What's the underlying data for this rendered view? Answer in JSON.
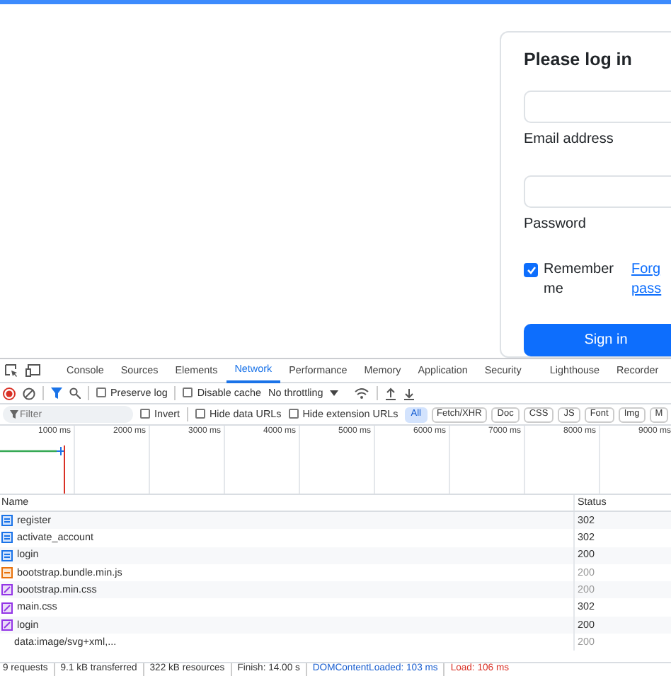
{
  "login": {
    "title": "Please log in",
    "fields": [
      {
        "label": "Email address"
      },
      {
        "label": "Password"
      }
    ],
    "remember": {
      "label": "Remember me",
      "checked": true
    },
    "forgot_link": [
      "Forg",
      "pass"
    ],
    "submit": "Sign in"
  },
  "devtools": {
    "tabs": [
      {
        "label": "Console",
        "selected": false
      },
      {
        "label": "Sources",
        "selected": false
      },
      {
        "label": "Elements",
        "selected": false
      },
      {
        "label": "Network",
        "selected": true
      },
      {
        "label": "Performance",
        "selected": false
      },
      {
        "label": "Memory",
        "selected": false
      },
      {
        "label": "Application",
        "selected": false
      },
      {
        "label": "Security",
        "selected": false
      },
      {
        "label": "Lighthouse",
        "selected": false
      },
      {
        "label": "Recorder",
        "selected": false
      }
    ],
    "toolbar": {
      "preserve_log": {
        "label": "Preserve log",
        "checked": false
      },
      "disable_cache": {
        "label": "Disable cache",
        "checked": false
      },
      "throttling": "No throttling"
    },
    "filter": {
      "placeholder": "Filter",
      "invert": {
        "label": "Invert",
        "checked": false
      },
      "hide_data_urls": {
        "label": "Hide data URLs",
        "checked": false
      },
      "hide_extension_urls": {
        "label": "Hide extension URLs",
        "checked": false
      },
      "types": [
        {
          "label": "All",
          "selected": true
        },
        {
          "label": "Fetch/XHR",
          "selected": false
        },
        {
          "label": "Doc",
          "selected": false
        },
        {
          "label": "CSS",
          "selected": false
        },
        {
          "label": "JS",
          "selected": false
        },
        {
          "label": "Font",
          "selected": false
        },
        {
          "label": "Img",
          "selected": false
        },
        {
          "label": "M",
          "selected": false
        }
      ]
    },
    "timeline": {
      "ticks": [
        "1000 ms",
        "2000 ms",
        "3000 ms",
        "4000 ms",
        "5000 ms",
        "6000 ms",
        "7000 ms",
        "8000 ms",
        "9000 ms"
      ]
    },
    "table": {
      "columns": [
        "Name",
        "Status"
      ],
      "rows": [
        {
          "name": "register",
          "kind": "document",
          "status": "302",
          "dimmed": false
        },
        {
          "name": "activate_account",
          "kind": "document",
          "status": "302",
          "dimmed": false
        },
        {
          "name": "login",
          "kind": "document",
          "status": "200",
          "dimmed": false
        },
        {
          "name": "bootstrap.bundle.min.js",
          "kind": "script",
          "status": "200",
          "dimmed": true
        },
        {
          "name": "bootstrap.min.css",
          "kind": "stylesheet",
          "status": "200",
          "dimmed": true
        },
        {
          "name": "main.css",
          "kind": "stylesheet",
          "status": "302",
          "dimmed": false
        },
        {
          "name": "login",
          "kind": "stylesheet",
          "status": "200",
          "dimmed": false
        },
        {
          "name": "data:image/svg+xml,...",
          "kind": "image",
          "status": "200",
          "dimmed": true
        }
      ]
    },
    "status_bar": [
      {
        "text": "9 requests",
        "kind": "plain"
      },
      {
        "text": "9.1 kB transferred",
        "kind": "plain"
      },
      {
        "text": "322 kB resources",
        "kind": "plain"
      },
      {
        "text": "Finish: 14.00 s",
        "kind": "plain"
      },
      {
        "text": "DOMContentLoaded: 103 ms",
        "kind": "dcl"
      },
      {
        "text": "Load: 106 ms",
        "kind": "load"
      }
    ]
  }
}
